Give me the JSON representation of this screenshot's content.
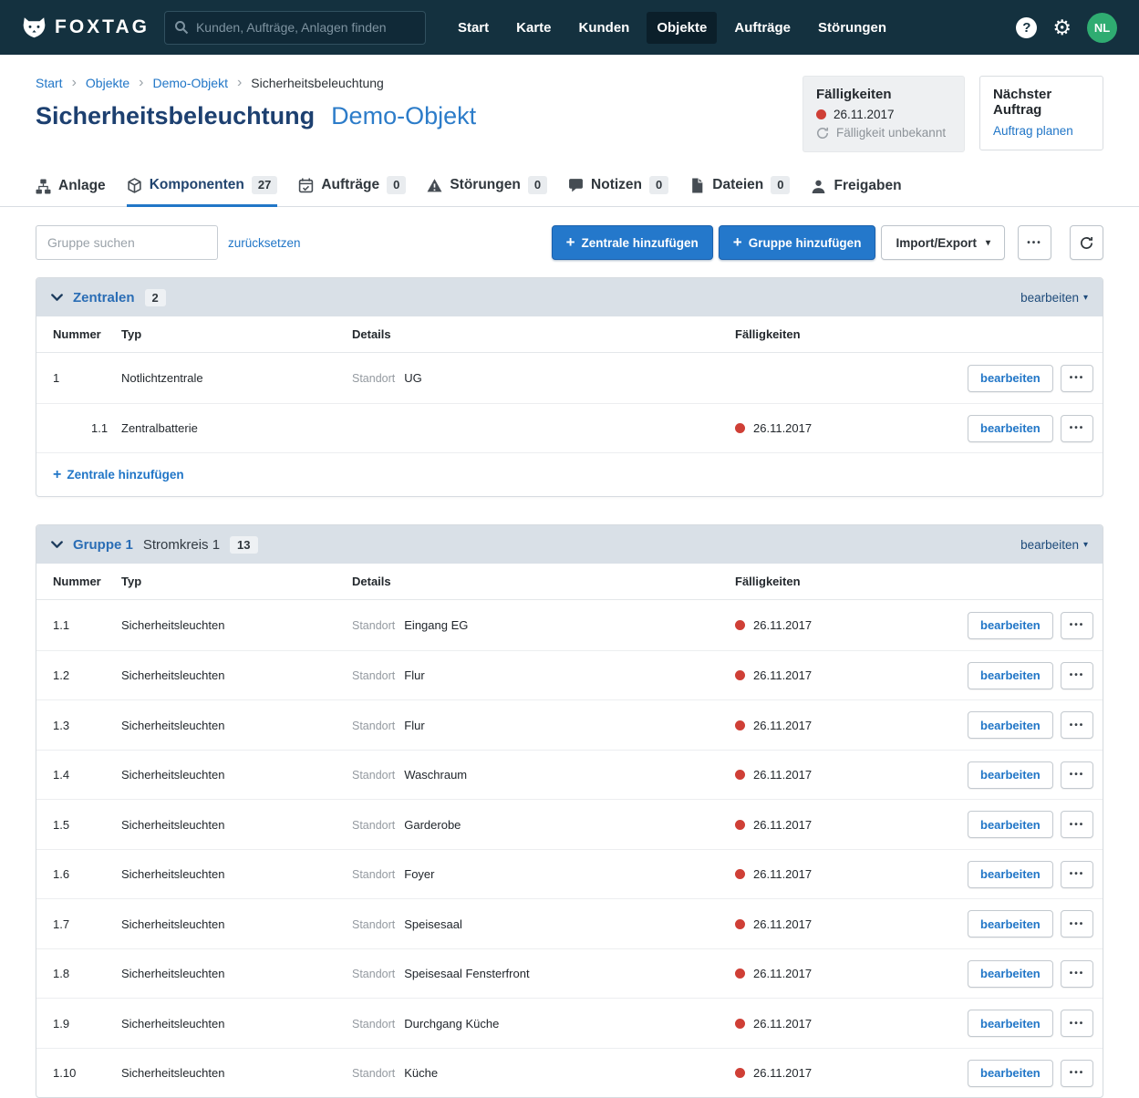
{
  "navbar": {
    "brand": "FOXTAG",
    "search_placeholder": "Kunden, Aufträge, Anlagen finden",
    "items": [
      {
        "label": "Start",
        "active": false
      },
      {
        "label": "Karte",
        "active": false
      },
      {
        "label": "Kunden",
        "active": false
      },
      {
        "label": "Objekte",
        "active": true
      },
      {
        "label": "Aufträge",
        "active": false
      },
      {
        "label": "Störungen",
        "active": false
      }
    ],
    "avatar_initials": "NL"
  },
  "breadcrumb": [
    "Start",
    "Objekte",
    "Demo-Objekt",
    "Sicherheitsbeleuchtung"
  ],
  "page": {
    "title": "Sicherheitsbeleuchtung",
    "subtitle": "Demo-Objekt"
  },
  "faelligkeiten_box": {
    "title": "Fälligkeiten",
    "date": "26.11.2017",
    "unknown": "Fälligkeit unbekannt"
  },
  "next_order_box": {
    "title": "Nächster Auftrag",
    "link": "Auftrag planen"
  },
  "tabs": [
    {
      "label": "Anlage"
    },
    {
      "label": "Komponenten",
      "count": "27",
      "active": true
    },
    {
      "label": "Aufträge",
      "count": "0"
    },
    {
      "label": "Störungen",
      "count": "0"
    },
    {
      "label": "Notizen",
      "count": "0"
    },
    {
      "label": "Dateien",
      "count": "0"
    },
    {
      "label": "Freigaben"
    }
  ],
  "toolbar": {
    "search_placeholder": "Gruppe suchen",
    "reset_label": "zurücksetzen",
    "add_zentrale_label": "Zentrale hinzufügen",
    "add_gruppe_label": "Gruppe hinzufügen",
    "import_export_label": "Import/Export"
  },
  "ui": {
    "standort_label": "Standort",
    "row_edit_label": "bearbeiten",
    "more_label": "•••"
  },
  "icons": {
    "gear": "⚙",
    "help": "?",
    "plus": "+",
    "caret_down": "▾",
    "breadcrumb_sep": "›"
  },
  "colors": {
    "navbar_bg": "#14313f",
    "primary_blue": "#2478cb",
    "link_blue": "#2176c7",
    "title_navy": "#1d4070",
    "subtitle_blue": "#2c7cc9",
    "due_red": "#cf3f36",
    "avatar_green": "#2fac71",
    "section_header_bg": "#d9e0e7"
  },
  "sections": [
    {
      "title": "Zentralen",
      "subtitle": "",
      "count": "2",
      "edit_label": "bearbeiten",
      "columns": [
        "Nummer",
        "Typ",
        "Details",
        "Fälligkeiten"
      ],
      "rows": [
        {
          "nummer": "1",
          "typ": "Notlichtzentrale",
          "standort": "UG",
          "due": "",
          "indent": false
        },
        {
          "nummer": "1.1",
          "typ": "Zentralbatterie",
          "standort": "",
          "due": "26.11.2017",
          "indent": true
        }
      ],
      "footer_link": "Zentrale hinzufügen"
    },
    {
      "title": "Gruppe 1",
      "subtitle": "Stromkreis 1",
      "count": "13",
      "edit_label": "bearbeiten",
      "columns": [
        "Nummer",
        "Typ",
        "Details",
        "Fälligkeiten"
      ],
      "rows": [
        {
          "nummer": "1.1",
          "typ": "Sicherheitsleuchten",
          "standort": "Eingang EG",
          "due": "26.11.2017"
        },
        {
          "nummer": "1.2",
          "typ": "Sicherheitsleuchten",
          "standort": "Flur",
          "due": "26.11.2017"
        },
        {
          "nummer": "1.3",
          "typ": "Sicherheitsleuchten",
          "standort": "Flur",
          "due": "26.11.2017"
        },
        {
          "nummer": "1.4",
          "typ": "Sicherheitsleuchten",
          "standort": "Waschraum",
          "due": "26.11.2017"
        },
        {
          "nummer": "1.5",
          "typ": "Sicherheitsleuchten",
          "standort": "Garderobe",
          "due": "26.11.2017"
        },
        {
          "nummer": "1.6",
          "typ": "Sicherheitsleuchten",
          "standort": "Foyer",
          "due": "26.11.2017"
        },
        {
          "nummer": "1.7",
          "typ": "Sicherheitsleuchten",
          "standort": "Speisesaal",
          "due": "26.11.2017"
        },
        {
          "nummer": "1.8",
          "typ": "Sicherheitsleuchten",
          "standort": "Speisesaal Fensterfront",
          "due": "26.11.2017"
        },
        {
          "nummer": "1.9",
          "typ": "Sicherheitsleuchten",
          "standort": "Durchgang Küche",
          "due": "26.11.2017"
        },
        {
          "nummer": "1.10",
          "typ": "Sicherheitsleuchten",
          "standort": "Küche",
          "due": "26.11.2017"
        }
      ],
      "footer_link": ""
    }
  ]
}
